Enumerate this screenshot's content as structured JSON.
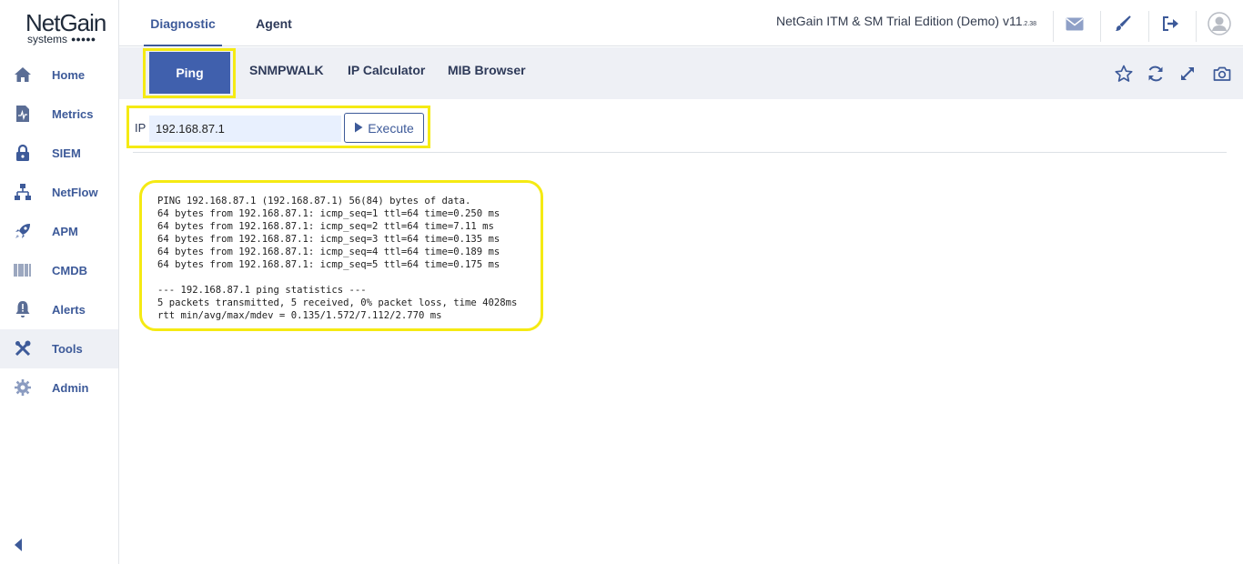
{
  "logo": {
    "name": "NetGain",
    "sub": "systems",
    "dots": "●●●●●"
  },
  "sidebar": {
    "items": [
      {
        "label": "Home",
        "icon": "home-icon"
      },
      {
        "label": "Metrics",
        "icon": "metrics-icon"
      },
      {
        "label": "SIEM",
        "icon": "lock-icon"
      },
      {
        "label": "NetFlow",
        "icon": "netflow-icon"
      },
      {
        "label": "APM",
        "icon": "rocket-icon"
      },
      {
        "label": "CMDB",
        "icon": "barcode-icon"
      },
      {
        "label": "Alerts",
        "icon": "bell-alert-icon"
      },
      {
        "label": "Tools",
        "icon": "tools-icon",
        "active": true
      },
      {
        "label": "Admin",
        "icon": "gear-icon"
      }
    ]
  },
  "topbar": {
    "tabs": [
      "Diagnostic",
      "Agent"
    ],
    "product": "NetGain ITM & SM Trial Edition (Demo) v11",
    "version_sub": ".2.38"
  },
  "tools": {
    "tabs": [
      "Ping",
      "SNMPWALK",
      "IP Calculator",
      "MIB Browser"
    ]
  },
  "ip": {
    "label": "IP",
    "value": "192.168.87.1",
    "execute_label": "Execute"
  },
  "output": "PING 192.168.87.1 (192.168.87.1) 56(84) bytes of data.\n64 bytes from 192.168.87.1: icmp_seq=1 ttl=64 time=0.250 ms\n64 bytes from 192.168.87.1: icmp_seq=2 ttl=64 time=7.11 ms\n64 bytes from 192.168.87.1: icmp_seq=3 ttl=64 time=0.135 ms\n64 bytes from 192.168.87.1: icmp_seq=4 ttl=64 time=0.189 ms\n64 bytes from 192.168.87.1: icmp_seq=5 ttl=64 time=0.175 ms\n\n--- 192.168.87.1 ping statistics ---\n5 packets transmitted, 5 received, 0% packet loss, time 4028ms\nrtt min/avg/max/mdev = 0.135/1.572/7.112/2.770 ms",
  "colors": {
    "accent": "#3d5a99",
    "active_button": "#4060ad",
    "highlight": "#f5ea13"
  }
}
